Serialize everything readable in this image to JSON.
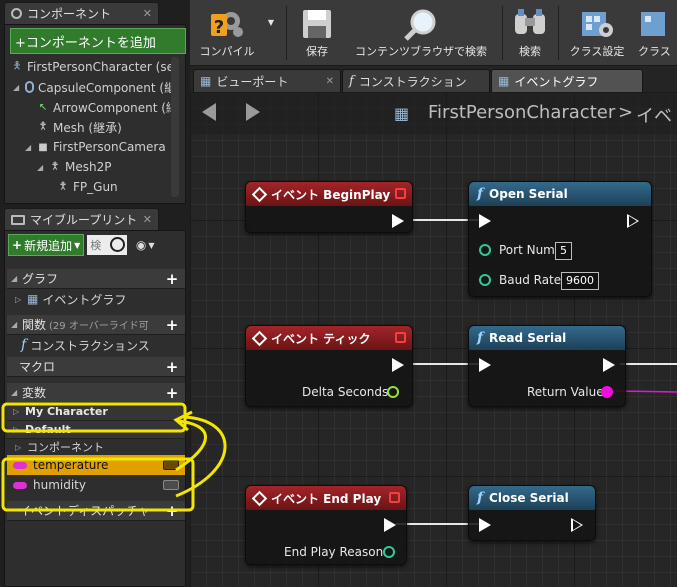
{
  "components_panel": {
    "tab_title": "コンポーネント",
    "add_button": "+コンポーネントを追加",
    "tree": [
      {
        "label": "FirstPersonCharacter (se",
        "icon": "person-icon",
        "indent": 0
      },
      {
        "label": "CapsuleComponent (継",
        "icon": "capsule-icon",
        "indent": 1
      },
      {
        "label": "ArrowComponent (継",
        "icon": "arrow-icon",
        "indent": 2
      },
      {
        "label": "Mesh (継承)",
        "icon": "mesh-icon",
        "indent": 2
      },
      {
        "label": "FirstPersonCamera",
        "icon": "camera-icon",
        "indent": 1
      },
      {
        "label": "Mesh2P",
        "icon": "mesh-icon",
        "indent": 2
      },
      {
        "label": "FP_Gun",
        "icon": "mesh-icon",
        "indent": 3
      }
    ]
  },
  "my_blueprint": {
    "tab_title": "マイブループリント",
    "new_button": "新規追加",
    "search_placeholder": "検",
    "sections": {
      "graph": "グラフ",
      "event_graph": "イベントグラフ",
      "functions": "関数",
      "functions_note": "(29 オーバーライド可",
      "construction": "コンストラクションス",
      "macro": "マクロ",
      "variables": "変数",
      "my_character": "My Character",
      "default": "Default",
      "components": "コンポーネント",
      "event_dispatcher": "イベントディスパッチャ"
    },
    "variables": [
      {
        "name": "temperature",
        "selected": true,
        "color": "#e02fd2"
      },
      {
        "name": "humidity",
        "selected": false,
        "color": "#e02fd2"
      }
    ]
  },
  "toolbar": {
    "compile": "コンパイル",
    "save": "保存",
    "browse": "コンテンツブラウザで検索",
    "search": "検索",
    "class_settings": "クラス設定",
    "class_defaults": "クラス"
  },
  "doc_tabs": {
    "viewport": "ビューポート",
    "construction": "コンストラクション",
    "event_graph": "イベントグラフ"
  },
  "graph": {
    "breadcrumb": "FirstPersonCharacter",
    "breadcrumb_sep": ">",
    "breadcrumb_next": "イベ",
    "nodes": {
      "begin_play": "イベント BeginPlay",
      "open_serial": "Open Serial",
      "port_num_label": "Port Num",
      "port_num_value": "5",
      "baud_rate_label": "Baud Rate",
      "baud_rate_value": "9600",
      "tick": "イベント ティック",
      "delta_seconds": "Delta Seconds",
      "read_serial": "Read Serial",
      "return_value": "Return Value",
      "end_play": "イベント End Play",
      "end_play_reason": "End Play Reason",
      "close_serial": "Close Serial"
    }
  },
  "colors": {
    "accent_green": "#317b2c",
    "event_red": "#a32428",
    "function_blue": "#336a8c",
    "highlight_yellow": "#f2e600",
    "string_pin": "#f00ede"
  }
}
